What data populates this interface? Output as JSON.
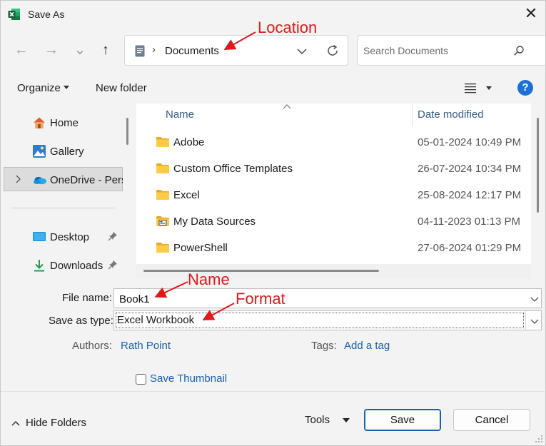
{
  "window": {
    "title": "Save As",
    "app_icon": "excel-icon",
    "close_glyph": "✕"
  },
  "nav": {
    "back_glyph": "←",
    "forward_glyph": "→",
    "recent_glyph": "⌄",
    "up_glyph": "↑",
    "address": {
      "separator": "›",
      "location": "Documents"
    },
    "search_placeholder": "Search Documents"
  },
  "toolbar": {
    "organize": "Organize",
    "new_folder": "New folder",
    "help": "?"
  },
  "sidebar": {
    "items": [
      {
        "label": "Home",
        "icon": "home-icon"
      },
      {
        "label": "Gallery",
        "icon": "gallery-icon"
      },
      {
        "label": "OneDrive - Pers",
        "icon": "onedrive-icon",
        "selected": true
      },
      {
        "label": "Desktop",
        "icon": "desktop-icon",
        "pinned": true
      },
      {
        "label": "Downloads",
        "icon": "downloads-icon",
        "pinned": true
      }
    ]
  },
  "files": {
    "columns": {
      "name": "Name",
      "date": "Date modified"
    },
    "rows": [
      {
        "name": "Adobe",
        "date": "05-01-2024 10:49 PM",
        "icon": "folder-icon"
      },
      {
        "name": "Custom Office Templates",
        "date": "26-07-2024 10:34 PM",
        "icon": "folder-icon"
      },
      {
        "name": "Excel",
        "date": "25-08-2024 12:17 PM",
        "icon": "folder-icon"
      },
      {
        "name": "My Data Sources",
        "date": "04-11-2023 01:13 PM",
        "icon": "data-sources-folder-icon"
      },
      {
        "name": "PowerShell",
        "date": "27-06-2024 01:29 PM",
        "icon": "folder-icon"
      }
    ]
  },
  "form": {
    "file_name_label": "File name:",
    "file_name_value": "Book1",
    "save_type_label": "Save as type:",
    "save_type_value": "Excel Workbook",
    "authors_label": "Authors:",
    "authors_value": "Rath Point",
    "tags_label": "Tags:",
    "tags_value": "Add a tag",
    "save_thumbnail_label": "Save Thumbnail",
    "save_thumbnail_checked": false
  },
  "footer": {
    "hide_folders": "Hide Folders",
    "tools": "Tools",
    "save": "Save",
    "cancel": "Cancel"
  },
  "annotations": {
    "location": "Location",
    "name": "Name",
    "format": "Format",
    "color": "#e0191b"
  }
}
